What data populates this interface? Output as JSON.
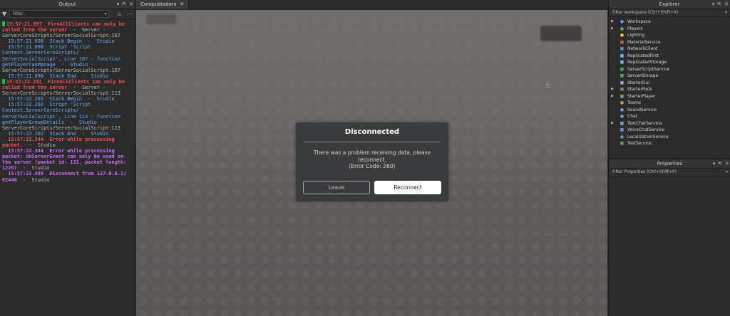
{
  "output": {
    "title": "Output",
    "filter_placeholder": "Filter...",
    "lines": [
      {
        "cls": "err",
        "marker": true,
        "text": "15:57:21.697  FireAllClients can only be"
      },
      {
        "cls": "err",
        "text": "called from the server",
        "tail": "  -  Server -"
      },
      {
        "cls": "gray",
        "text": "ServerCoreScripts/ServerSocialScript:167"
      },
      {
        "cls": "info",
        "text": "  15:57:21.698  Stack Begin  -  Studio"
      },
      {
        "cls": "info",
        "text": "  15:57:21.698  Script 'Script"
      },
      {
        "cls": "info",
        "text": "Context.ServerCoreScripts/"
      },
      {
        "cls": "info",
        "text": "ServerSocialScript', Line 167 - function"
      },
      {
        "cls": "info",
        "text": "getPlayerCanManage  -  Studio -"
      },
      {
        "cls": "gray",
        "text": "ServerCoreScripts/ServerSocialScript:167"
      },
      {
        "cls": "info",
        "text": "  15:57:21.698  Stack End  -  Studio"
      },
      {
        "cls": "err",
        "marker": true,
        "text": "15:57:22.292  FireAllClients can only be"
      },
      {
        "cls": "err",
        "text": "called from the server",
        "tail": "  -  Server -"
      },
      {
        "cls": "gray",
        "text": "ServerCoreScripts/ServerSocialScript:113"
      },
      {
        "cls": "info",
        "text": "  15:57:22.292  Stack Begin  -  Studio"
      },
      {
        "cls": "info",
        "text": "  15:57:22.292  Script 'Script"
      },
      {
        "cls": "info",
        "text": "Context.ServerCoreScripts/"
      },
      {
        "cls": "info",
        "text": "ServerSocialScript', Line 113 - function"
      },
      {
        "cls": "info",
        "text": "getPlayerGroupDetails  -  Studio -"
      },
      {
        "cls": "gray",
        "text": "ServerCoreScripts/ServerSocialScript:113"
      },
      {
        "cls": "info",
        "text": "  15:57:22.292  Stack End  -  Studio"
      },
      {
        "cls": "err",
        "text": "  15:57:22.344  Error while processing"
      },
      {
        "cls": "err",
        "text": "packet.",
        "tail": "  -  Studio"
      },
      {
        "cls": "purple",
        "text": "  15:57:22.344  Error while processing"
      },
      {
        "cls": "purple",
        "text": "packet: OnServerEvent can only be used on"
      },
      {
        "cls": "purple",
        "text": "the server (packet id: 131, packet length:"
      },
      {
        "cls": "purple",
        "text": "1220)",
        "tail": "  -  Studio"
      },
      {
        "cls": "purple",
        "text": "  15:57:22.489  Disconnect from 127.0.0.1|"
      },
      {
        "cls": "purple",
        "text": "62446",
        "tail": "  -  Studio"
      }
    ]
  },
  "tabs": [
    {
      "label": "Conquistadors",
      "close": "✕"
    }
  ],
  "dialog": {
    "title": "Disconnected",
    "message_line1": "There was a problem receiving data, please",
    "message_line2": "reconnect.",
    "message_line3": "(Error Code: 260)",
    "leave_label": "Leave",
    "reconnect_label": "Reconnect"
  },
  "explorer": {
    "title": "Explorer",
    "filter_placeholder": "Filter workspace (Ctrl+Shift+X)",
    "items": [
      {
        "label": "Workspace",
        "arrow": true,
        "color": "#4aa3ff",
        "glyph": "●"
      },
      {
        "label": "Players",
        "arrow": true,
        "color": "#4fbf5a",
        "glyph": "●"
      },
      {
        "label": "Lighting",
        "arrow": false,
        "color": "#f2d13a",
        "glyph": "●"
      },
      {
        "label": "MaterialService",
        "arrow": false,
        "color": "#c85a5a",
        "glyph": "■"
      },
      {
        "label": "NetworkClient",
        "arrow": false,
        "color": "#5a8fd8",
        "glyph": "■"
      },
      {
        "label": "ReplicatedFirst",
        "arrow": false,
        "color": "#6fb0e8",
        "glyph": "■"
      },
      {
        "label": "ReplicatedStorage",
        "arrow": false,
        "color": "#6fb0e8",
        "glyph": "■"
      },
      {
        "label": "ServerScriptService",
        "arrow": false,
        "color": "#3fae5a",
        "glyph": "■"
      },
      {
        "label": "ServerStorage",
        "arrow": false,
        "color": "#3fae5a",
        "glyph": "■"
      },
      {
        "label": "StarterGui",
        "arrow": false,
        "color": "#8fa2d8",
        "glyph": "■"
      },
      {
        "label": "StarterPack",
        "arrow": true,
        "color": "#8a7a5a",
        "glyph": "■"
      },
      {
        "label": "StarterPlayer",
        "arrow": true,
        "color": "#5ab0a0",
        "glyph": "■"
      },
      {
        "label": "Teams",
        "arrow": false,
        "color": "#e0a030",
        "glyph": "●"
      },
      {
        "label": "SoundService",
        "arrow": false,
        "color": "#7aa0c8",
        "glyph": "●"
      },
      {
        "label": "Chat",
        "arrow": false,
        "color": "#6aa8e0",
        "glyph": "●"
      },
      {
        "label": "TextChatService",
        "arrow": true,
        "color": "#6aa8e0",
        "glyph": "■"
      },
      {
        "label": "VoiceChatService",
        "arrow": false,
        "color": "#5a9ae0",
        "glyph": "■"
      },
      {
        "label": "LocalizationService",
        "arrow": false,
        "color": "#5a9ae0",
        "glyph": "●"
      },
      {
        "label": "TestService",
        "arrow": false,
        "color": "#4fa84f",
        "glyph": "■"
      }
    ]
  },
  "properties": {
    "title": "Properties",
    "filter_placeholder": "Filter Properties (Ctrl+Shift+P)"
  }
}
